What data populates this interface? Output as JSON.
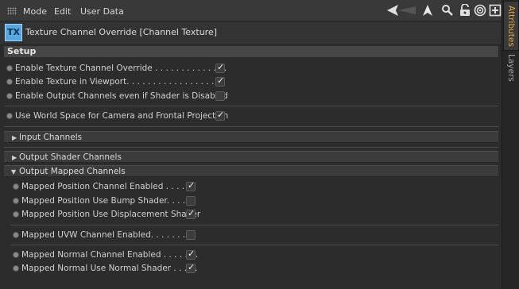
{
  "menubar": {
    "items": [
      "Mode",
      "Edit",
      "User Data"
    ]
  },
  "header": {
    "badge": "TX",
    "title": "Texture Channel Override [Channel Texture]"
  },
  "section": {
    "title": "Setup"
  },
  "setup_rows": [
    {
      "label": "Enable Texture Channel Override . . . . . . . . . . . . . .",
      "checked": true
    },
    {
      "label": "Enable Texture in Viewport. . . . . . . . . . . . . . . . . .",
      "checked": true
    },
    {
      "label": "Enable Output Channels even if Shader is Disabled",
      "checked": false
    },
    {
      "label": "Use World Space for Camera and Frontal Projection",
      "checked": true
    }
  ],
  "groups": {
    "input": "Input Channels",
    "output_shader": "Output Shader Channels",
    "output_mapped": "Output Mapped Channels"
  },
  "mapped_rows": [
    {
      "label": "Mapped Position Channel Enabled . . . . . .",
      "checked": true
    },
    {
      "label": "Mapped Position Use Bump Shader. . . . . .",
      "checked": false
    },
    {
      "label": "Mapped Position Use Displacement Shader",
      "checked": true
    },
    {
      "label": "Mapped UVW Channel Enabled. . . . . . . . .",
      "checked": false
    },
    {
      "label": "Mapped Normal Channel Enabled . . . . . . .",
      "checked": true
    },
    {
      "label": "Mapped Normal Use Normal Shader . . . . .",
      "checked": true
    }
  ],
  "sidetabs": [
    "Attributes",
    "Layers"
  ],
  "colors": {
    "badge": "#56a8e0",
    "active_tab": "#e2a33c",
    "background": "#2c2c2c"
  }
}
